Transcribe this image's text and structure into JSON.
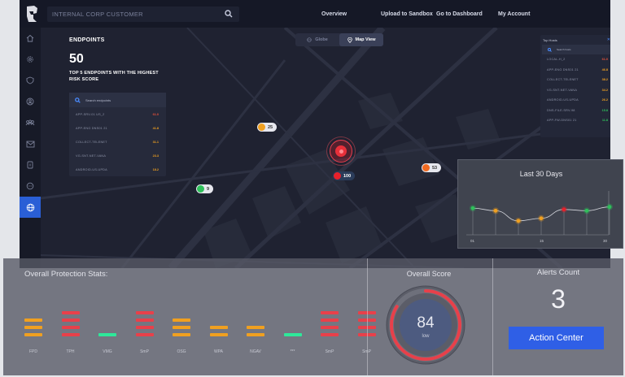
{
  "header": {
    "search_placeholder": "INTERNAL CORP CUSTOMER",
    "nav": [
      "Overview",
      "Upload to Sandbox",
      "Go to Dashboard",
      "My Account"
    ]
  },
  "sidebar": {
    "icons": [
      "home-icon",
      "gear-icon",
      "shield-icon",
      "user-shield-icon",
      "group-icon",
      "mail-icon",
      "document-icon",
      "chat-icon",
      "globe-icon"
    ],
    "active_index": 8
  },
  "endpoints": {
    "title": "ENDPOINTS",
    "count": "50",
    "subtitle": "TOP 5 ENDPOINTS WITH THE HIGHEST RISK SCORE",
    "search_placeholder": "Search endpoints",
    "rows": [
      {
        "name": "APP-SRV-01 US_2",
        "value": "61.0",
        "color": "#e8523a"
      },
      {
        "name": "APP-ENG DNS01 21",
        "value": "41.8",
        "color": "#f0a020"
      },
      {
        "name": "COLLECT-TELENET",
        "value": "31.1",
        "color": "#f0a020"
      },
      {
        "name": "VG-SNT-NET-VANA",
        "value": "23.3",
        "color": "#f0a020"
      },
      {
        "name": "ANDROID-US-UPDA",
        "value": "18.2",
        "color": "#f0a020"
      }
    ]
  },
  "view_toggle": {
    "globe": "Globe",
    "map": "Map View"
  },
  "map_pins": [
    {
      "label": "25",
      "color": "#f0a020"
    },
    {
      "label": "100",
      "color": "#e8202a"
    },
    {
      "label": "53",
      "color": "#f06a20"
    },
    {
      "label": "9",
      "color": "#2ec05a"
    }
  ],
  "top_hosts": {
    "title": "Top Hosts",
    "search_placeholder": "Search hosts",
    "rows": [
      {
        "name": "LOCAL-H_2",
        "value": "61.0",
        "color": "#e8523a"
      },
      {
        "name": "APP-ENG DNS01 21",
        "value": "46.8",
        "color": "#f0a020"
      },
      {
        "name": "COLLECT-TELENET",
        "value": "38.2",
        "color": "#f0a020"
      },
      {
        "name": "VG-SNT-NET-VANA",
        "value": "34.2",
        "color": "#f0a020"
      },
      {
        "name": "ANDROID-US-UPDA",
        "value": "26.2",
        "color": "#f0a020"
      },
      {
        "name": "DNS-FILE-SRV-98",
        "value": "15.8",
        "color": "#2ec05a"
      },
      {
        "name": "APP-FW-DNS01 21",
        "value": "11.8",
        "color": "#2ec05a"
      }
    ]
  },
  "trend": {
    "title": "Last 30 Days",
    "tick_labels": [
      "01",
      "15",
      "30"
    ],
    "points": [
      {
        "value": 62,
        "color": "#2ec05a"
      },
      {
        "value": 58,
        "color": "#f0a020"
      },
      {
        "value": 42,
        "color": "#f0a020"
      },
      {
        "value": 46,
        "color": "#f0a020"
      },
      {
        "value": 60,
        "color": "#e8202a"
      },
      {
        "value": 58,
        "color": "#2ec05a"
      },
      {
        "value": 64,
        "color": "#2ec05a"
      }
    ]
  },
  "protection": {
    "title": "Overall Protection Stats:",
    "bars": [
      {
        "label": "FPD",
        "level": 3,
        "color": "#f0a020"
      },
      {
        "label": "TPH",
        "level": 4,
        "color": "#e8404a"
      },
      {
        "label": "VMG",
        "level": 1,
        "color": "#2ee89a"
      },
      {
        "label": "SmP",
        "level": 4,
        "color": "#e8404a"
      },
      {
        "label": "OSG",
        "level": 3,
        "color": "#f0a020"
      },
      {
        "label": "WPA",
        "level": 2,
        "color": "#f0a020"
      },
      {
        "label": "NGAV",
        "level": 2,
        "color": "#f0a020"
      },
      {
        "label": "***",
        "level": 1,
        "color": "#2ee89a"
      },
      {
        "label": "SmP",
        "level": 4,
        "color": "#e8404a"
      },
      {
        "label": "SmP",
        "level": 4,
        "color": "#e8404a"
      }
    ]
  },
  "score": {
    "title": "Overall Score",
    "value": "84",
    "level_label": "low",
    "fraction": 0.84
  },
  "alerts": {
    "title": "Alerts Count",
    "value": "3",
    "action_label": "Action Center"
  }
}
